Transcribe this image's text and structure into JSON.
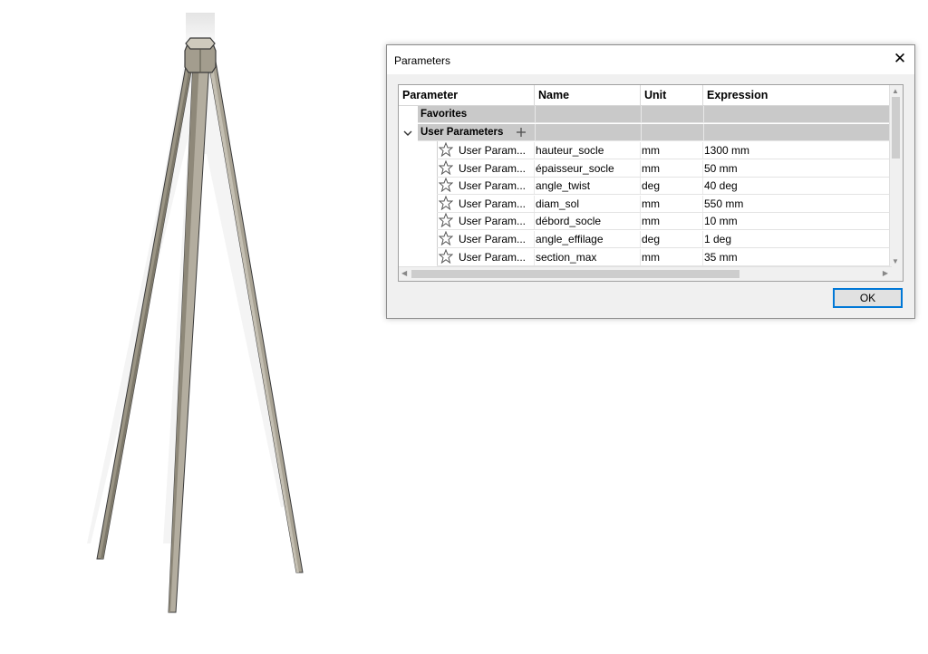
{
  "dialog": {
    "title": "Parameters",
    "ok_label": "OK"
  },
  "grid": {
    "columns": [
      "Parameter",
      "Name",
      "Unit",
      "Expression"
    ],
    "groups": {
      "favorites": "Favorites",
      "user_parameters": "User Parameters"
    },
    "rows": [
      {
        "parameter": "User Param...",
        "name": "hauteur_socle",
        "unit": "mm",
        "expression": "1300 mm"
      },
      {
        "parameter": "User Param...",
        "name": "épaisseur_socle",
        "unit": "mm",
        "expression": "50 mm"
      },
      {
        "parameter": "User Param...",
        "name": "angle_twist",
        "unit": "deg",
        "expression": "40 deg"
      },
      {
        "parameter": "User Param...",
        "name": "diam_sol",
        "unit": "mm",
        "expression": "550 mm"
      },
      {
        "parameter": "User Param...",
        "name": "débord_socle",
        "unit": "mm",
        "expression": "10 mm"
      },
      {
        "parameter": "User Param...",
        "name": "angle_effilage",
        "unit": "deg",
        "expression": "1 deg"
      },
      {
        "parameter": "User Param...",
        "name": "section_max",
        "unit": "mm",
        "expression": "35 mm"
      }
    ]
  },
  "icons": {
    "close": "close-icon",
    "collapse": "chevron-down-icon",
    "add": "plus-icon",
    "favorite": "star-outline-icon"
  },
  "colors": {
    "accent": "#0078d7",
    "group_band": "#c9c9c9",
    "model": "#a39d8e"
  }
}
